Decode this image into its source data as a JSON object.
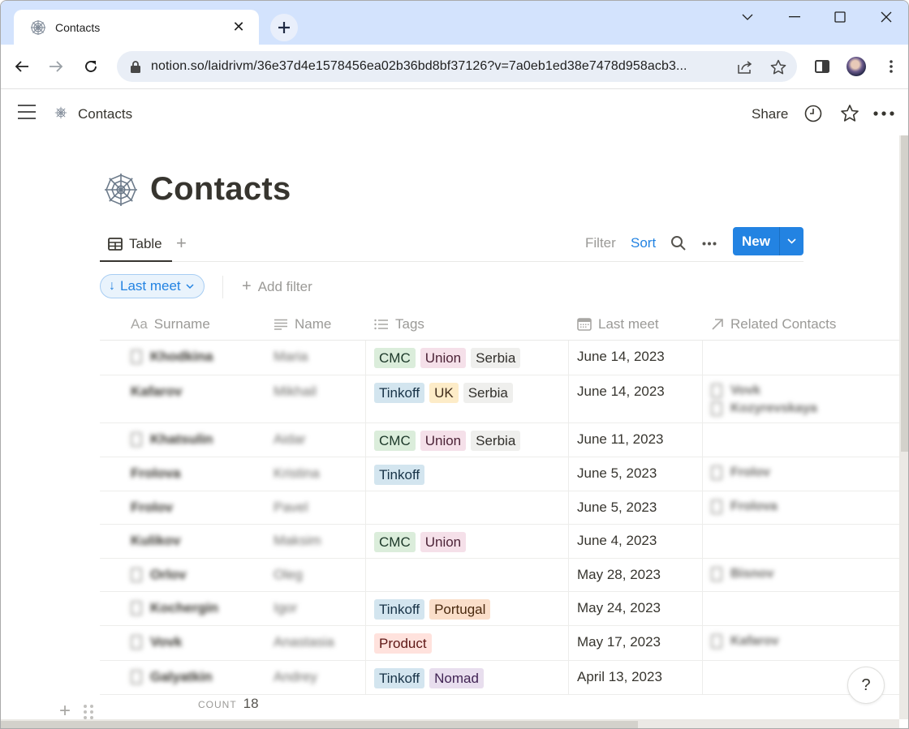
{
  "browser": {
    "tab_title": "Contacts",
    "new_tab_label": "+",
    "url": "notion.so/laidrivm/36e37d4e1578456ea02b36bd8bf37126?v=7a0eb1ed38e7478d958acb3..."
  },
  "topbar": {
    "breadcrumb": "Contacts",
    "share_label": "Share"
  },
  "page": {
    "title": "Contacts",
    "icon": "spider-web-icon"
  },
  "views": {
    "active_tab": "Table",
    "add_view_label": "+",
    "filter_label": "Filter",
    "sort_label": "Sort",
    "new_label": "New"
  },
  "filters": {
    "sort_pill": "Last meet",
    "add_filter_label": "Add filter"
  },
  "table": {
    "columns": [
      {
        "label": "Surname",
        "icon": "Aa"
      },
      {
        "label": "Name",
        "icon": "text-icon"
      },
      {
        "label": "Tags",
        "icon": "multi-select-icon"
      },
      {
        "label": "Last meet",
        "icon": "calendar-icon"
      },
      {
        "label": "Related Contacts",
        "icon": "relation-arrow-icon"
      }
    ],
    "rows": [
      {
        "surname": "Khodkina",
        "name": "Maria",
        "has_doc": true,
        "tags": [
          "CMC",
          "Union",
          "Serbia"
        ],
        "date": "June 14, 2023",
        "related": []
      },
      {
        "surname": "Kafarov",
        "name": "Mikhail",
        "has_doc": false,
        "tags": [
          "Tinkoff",
          "UK",
          "Serbia"
        ],
        "date": "June 14, 2023",
        "related": [
          "Vovk",
          "Kozyrevskaya"
        ]
      },
      {
        "surname": "Khatsulin",
        "name": "Aidar",
        "has_doc": true,
        "tags": [
          "CMC",
          "Union",
          "Serbia"
        ],
        "date": "June 11, 2023",
        "related": []
      },
      {
        "surname": "Frolova",
        "name": "Kristina",
        "has_doc": false,
        "tags": [
          "Tinkoff"
        ],
        "date": "June 5, 2023",
        "related": [
          "Frolov"
        ]
      },
      {
        "surname": "Frolov",
        "name": "Pavel",
        "has_doc": false,
        "tags": [],
        "date": "June 5, 2023",
        "related": [
          "Frolova"
        ]
      },
      {
        "surname": "Kulikov",
        "name": "Maksim",
        "has_doc": false,
        "tags": [
          "CMC",
          "Union"
        ],
        "date": "June 4, 2023",
        "related": []
      },
      {
        "surname": "Orlov",
        "name": "Oleg",
        "has_doc": true,
        "tags": [],
        "date": "May 28, 2023",
        "related": [
          "Bisnov"
        ]
      },
      {
        "surname": "Kochergin",
        "name": "Igor",
        "has_doc": true,
        "tags": [
          "Tinkoff",
          "Portugal"
        ],
        "date": "May 24, 2023",
        "related": []
      },
      {
        "surname": "Vovk",
        "name": "Anastasia",
        "has_doc": true,
        "tags": [
          "Product"
        ],
        "date": "May 17, 2023",
        "related": [
          "Kafarov"
        ]
      },
      {
        "surname": "Galyatkin",
        "name": "Andrey",
        "has_doc": true,
        "tags": [
          "Tinkoff",
          "Nomad"
        ],
        "date": "April 13, 2023",
        "related": []
      }
    ],
    "count_label": "COUNT",
    "count_value": "18"
  },
  "tag_colors": {
    "CMC": {
      "bg": "#dbeddb",
      "fg": "#1c3829"
    },
    "Union": {
      "bg": "#f5e0e9",
      "fg": "#4c2337"
    },
    "Serbia": {
      "bg": "#efefed",
      "fg": "#32302c"
    },
    "Tinkoff": {
      "bg": "#d3e5ef",
      "fg": "#183347"
    },
    "UK": {
      "bg": "#fdecc8",
      "fg": "#402c1b"
    },
    "Portugal": {
      "bg": "#fadec9",
      "fg": "#49290e"
    },
    "Product": {
      "bg": "#ffe2dd",
      "fg": "#5d1715"
    },
    "Nomad": {
      "bg": "#e8deee",
      "fg": "#412454"
    }
  },
  "help_label": "?"
}
